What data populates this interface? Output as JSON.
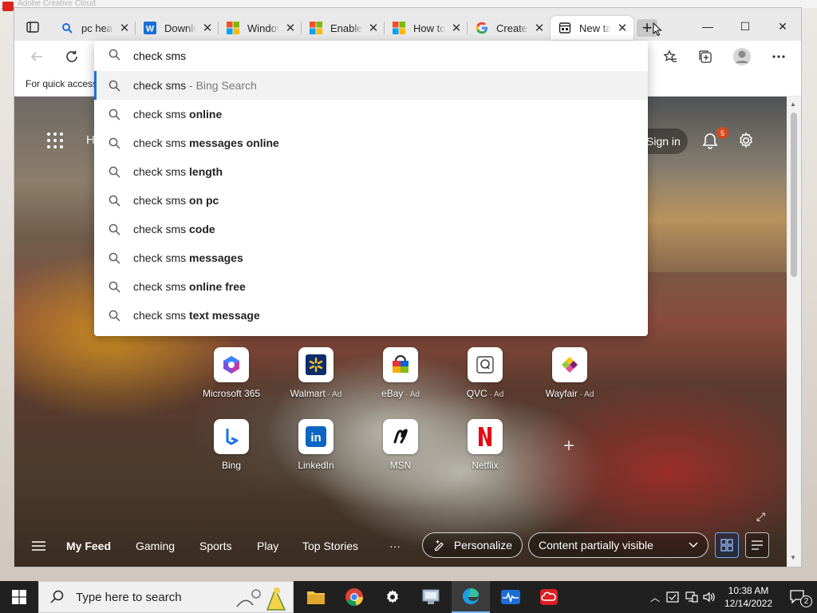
{
  "background_app": {
    "title": "Adobe Creative Cloud"
  },
  "tabs": [
    {
      "label": "pc health",
      "icon": "search-favicon"
    },
    {
      "label": "Download",
      "icon": "word-favicon"
    },
    {
      "label": "Windows",
      "icon": "microsoft-favicon"
    },
    {
      "label": "Enable",
      "icon": "microsoft-favicon"
    },
    {
      "label": "How to",
      "icon": "microsoft-favicon"
    },
    {
      "label": "Create",
      "icon": "google-favicon"
    },
    {
      "label": "New tab",
      "icon": "newtab-favicon",
      "active": true
    }
  ],
  "tab_close_glyph": "✕",
  "new_tab_glyph": "+",
  "window_controls": {
    "minimize": "—",
    "maximize": "☐",
    "close": "✕"
  },
  "favorites_bar": {
    "text": "For quick access"
  },
  "address": {
    "query": "check sms",
    "suggestions": [
      {
        "query": "check sms",
        "bold": "",
        "source": " - Bing Search",
        "selected": true
      },
      {
        "query": "check sms ",
        "bold": "online"
      },
      {
        "query": "check sms ",
        "bold": "messages online"
      },
      {
        "query": "check sms ",
        "bold": "length"
      },
      {
        "query": "check sms ",
        "bold": "on pc"
      },
      {
        "query": "check sms ",
        "bold": "code"
      },
      {
        "query": "check sms ",
        "bold": "messages"
      },
      {
        "query": "check sms ",
        "bold": "online free"
      },
      {
        "query": "check sms ",
        "bold": "text message"
      }
    ]
  },
  "newtab": {
    "header_letter": "H",
    "sign_in": "Sign in",
    "notifications_count": "5",
    "tiles": [
      {
        "label": "Microsoft 365",
        "ad": ""
      },
      {
        "label": "Walmart",
        "ad": " · Ad"
      },
      {
        "label": "eBay",
        "ad": " · Ad"
      },
      {
        "label": "QVC",
        "ad": " · Ad"
      },
      {
        "label": "Wayfair",
        "ad": " · Ad"
      },
      {
        "label": "Bing",
        "ad": ""
      },
      {
        "label": "LinkedIn",
        "ad": ""
      },
      {
        "label": "MSN",
        "ad": ""
      },
      {
        "label": "Netflix",
        "ad": ""
      }
    ],
    "feed": {
      "links": [
        "My Feed",
        "Gaming",
        "Sports",
        "Play",
        "Top Stories"
      ],
      "more": "···",
      "personalize": "Personalize",
      "content_visibility": "Content partially visible"
    }
  },
  "taskbar": {
    "search_placeholder": "Type here to search",
    "time": "10:38 AM",
    "date": "12/14/2022",
    "notification_count": "2"
  },
  "colors": {
    "accent": "#1e6fd9",
    "taskbar": "#202020",
    "badge": "#d34a1c"
  }
}
